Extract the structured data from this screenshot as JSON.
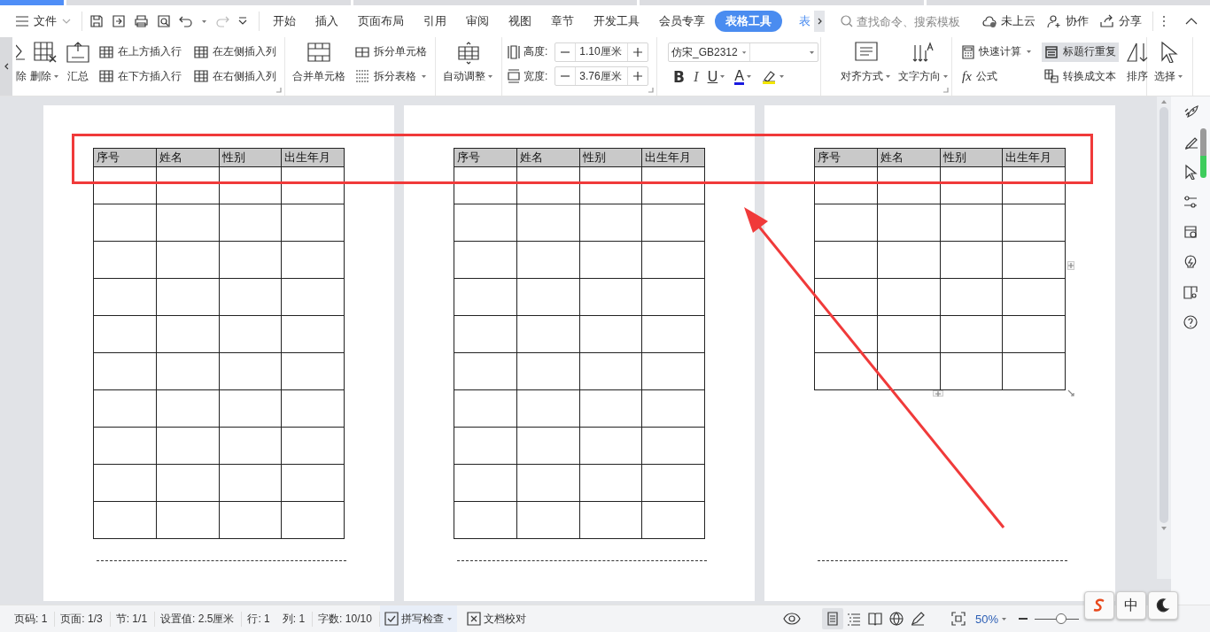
{
  "document_tabs": [
    {
      "selected": true
    },
    {
      "selected": false
    },
    {
      "selected": false
    },
    {
      "selected": false
    },
    {
      "selected": false
    }
  ],
  "menu": {
    "file": "文件",
    "tabs": [
      {
        "label": "开始",
        "selected": false
      },
      {
        "label": "插入",
        "selected": false
      },
      {
        "label": "页面布局",
        "selected": false
      },
      {
        "label": "引用",
        "selected": false
      },
      {
        "label": "审阅",
        "selected": false
      },
      {
        "label": "视图",
        "selected": false
      },
      {
        "label": "章节",
        "selected": false
      },
      {
        "label": "开发工具",
        "selected": false
      },
      {
        "label": "会员专享",
        "selected": false
      },
      {
        "label": "表格工具",
        "selected": true
      },
      {
        "label": "表",
        "selected": false
      }
    ],
    "search": {
      "placeholder": "查找命令、搜索模板"
    },
    "actions": [
      "未上云",
      "协作",
      "分享"
    ]
  },
  "ribbon": {
    "clear": "除",
    "delete": "删除",
    "summary": "汇总",
    "insert_above": "在上方插入行",
    "insert_below": "在下方插入行",
    "insert_left": "在左侧插入列",
    "insert_right": "在右侧插入列",
    "merge_cells": "合并单元格",
    "split_cells": "拆分单元格",
    "split_table": "拆分表格",
    "auto_fit": "自动调整",
    "height_label": "高度:",
    "height": "1.10厘米",
    "width_label": "宽度:",
    "width": "3.76厘米",
    "font_name": "仿宋_GB2312",
    "bold": "B",
    "italic": "I",
    "underline": "U",
    "font_color": "A",
    "align": "对齐方式",
    "text_direction": "文字方向",
    "quick_calc": "快速计算",
    "formula_icon": "fx",
    "formula": "公式",
    "repeat_header": {
      "label": "标题行重复",
      "selected": true
    },
    "to_text": "转换成文本",
    "sort": "排序",
    "select": "选择"
  },
  "pages": [
    {
      "table_handles": false,
      "table": {
        "columns": [
          "序号",
          "姓名",
          "性别",
          "出生年月"
        ],
        "rows": [
          {
            "kind": "blank"
          },
          {
            "kind": "blank"
          },
          {
            "kind": "blank"
          },
          {
            "kind": "blank"
          },
          {
            "kind": "blank"
          },
          {
            "kind": "blank"
          },
          {
            "kind": "blank"
          },
          {
            "kind": "blank"
          },
          {
            "kind": "blank"
          },
          {
            "kind": "blank"
          }
        ]
      }
    },
    {
      "table_handles": false,
      "table": {
        "columns": [
          "序号",
          "姓名",
          "性别",
          "出生年月"
        ],
        "rows": [
          {
            "kind": "blank"
          },
          {
            "kind": "blank"
          },
          {
            "kind": "blank"
          },
          {
            "kind": "blank"
          },
          {
            "kind": "blank"
          },
          {
            "kind": "blank"
          },
          {
            "kind": "blank"
          },
          {
            "kind": "blank"
          },
          {
            "kind": "blank"
          },
          {
            "kind": "blank"
          }
        ]
      }
    },
    {
      "table_handles": true,
      "table": {
        "columns": [
          "序号",
          "姓名",
          "性别",
          "出生年月"
        ],
        "rows": [
          {
            "kind": "blank"
          },
          {
            "kind": "blank"
          },
          {
            "kind": "blank"
          },
          {
            "kind": "blank"
          },
          {
            "kind": "blank"
          },
          {
            "kind": "blank"
          }
        ]
      }
    }
  ],
  "annotations": {
    "highlight_box": true,
    "arrow": true
  },
  "status_bar": {
    "items": [
      "页码: 1",
      "页面: 1/3",
      "节: 1/1",
      "设置值: 2.5厘米",
      "行: 1",
      "列: 1",
      "字数: 10/10"
    ],
    "spell_check": "拼写检查",
    "proofread": "文档校对",
    "views": [
      {
        "selected": true
      },
      {
        "selected": false
      },
      {
        "selected": false
      },
      {
        "selected": false
      },
      {
        "selected": false
      }
    ],
    "zoom": "50%",
    "zoom_slider": {
      "level": 0.6
    }
  },
  "ime": {
    "label": "中"
  }
}
